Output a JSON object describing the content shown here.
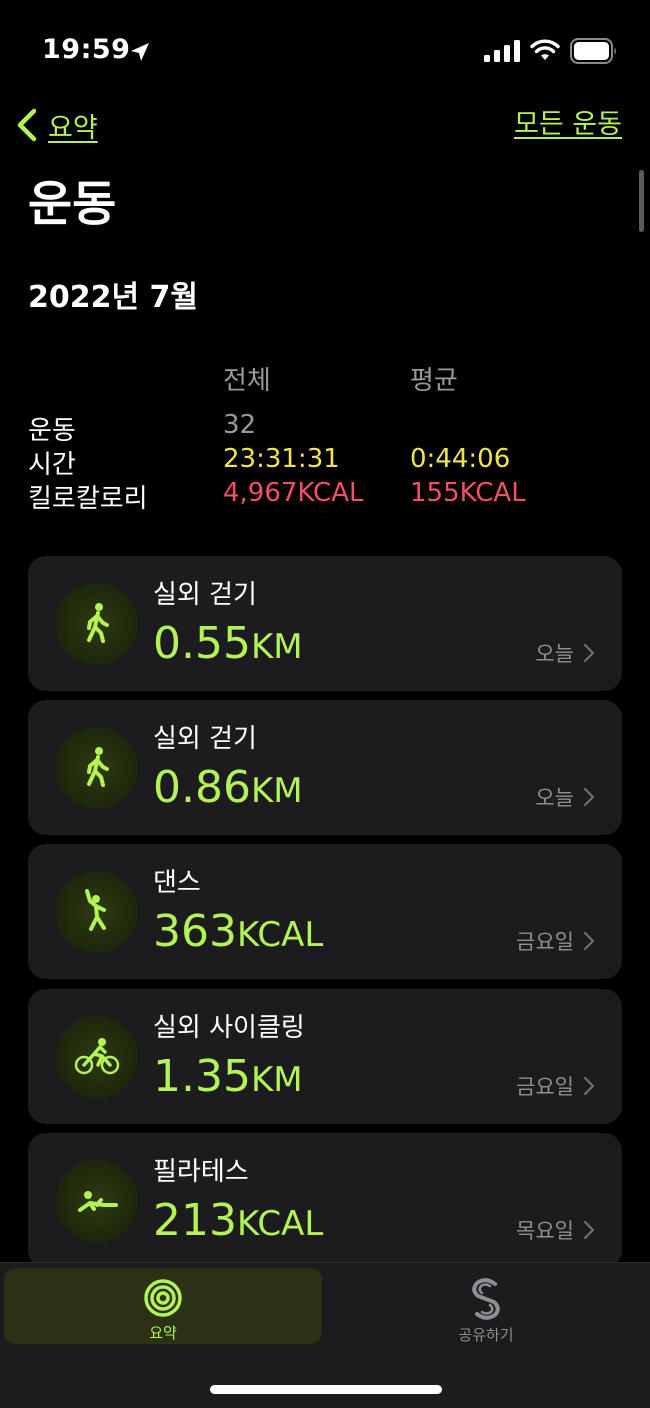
{
  "status": {
    "time": "19:59",
    "icons": [
      "location-arrow-icon",
      "cellular-signal-icon",
      "wifi-icon",
      "battery-icon"
    ]
  },
  "nav": {
    "back_label": "요약",
    "all_workouts_label": "모든 운동"
  },
  "title": "운동",
  "month": "2022년 7월",
  "summary": {
    "header_total": "전체",
    "header_average": "평균",
    "rows": [
      {
        "label": "운동",
        "total": "32",
        "average": ""
      },
      {
        "label": "시간",
        "total": "23:31:31",
        "average": "0:44:06"
      },
      {
        "label": "킬로칼로리",
        "total": "4,967KCAL",
        "average": "155KCAL"
      }
    ]
  },
  "workouts": [
    {
      "name": "실외 걷기",
      "value": "0.55",
      "unit": "KM",
      "day": "오늘",
      "icon": "walking-icon"
    },
    {
      "name": "실외 걷기",
      "value": "0.86",
      "unit": "KM",
      "day": "오늘",
      "icon": "walking-icon"
    },
    {
      "name": "댄스",
      "value": "363",
      "unit": "KCAL",
      "day": "금요일",
      "icon": "dance-icon"
    },
    {
      "name": "실외 사이클링",
      "value": "1.35",
      "unit": "KM",
      "day": "금요일",
      "icon": "cycling-icon"
    },
    {
      "name": "필라테스",
      "value": "213",
      "unit": "KCAL",
      "day": "목요일",
      "icon": "pilates-icon"
    }
  ],
  "tabs": {
    "summary_label": "요약",
    "share_label": "공유하기"
  },
  "colors": {
    "accent": "#b3f352",
    "time_yellow": "#f0e44b",
    "calorie_red": "#f54f66",
    "card_bg": "#1c1c1e"
  }
}
